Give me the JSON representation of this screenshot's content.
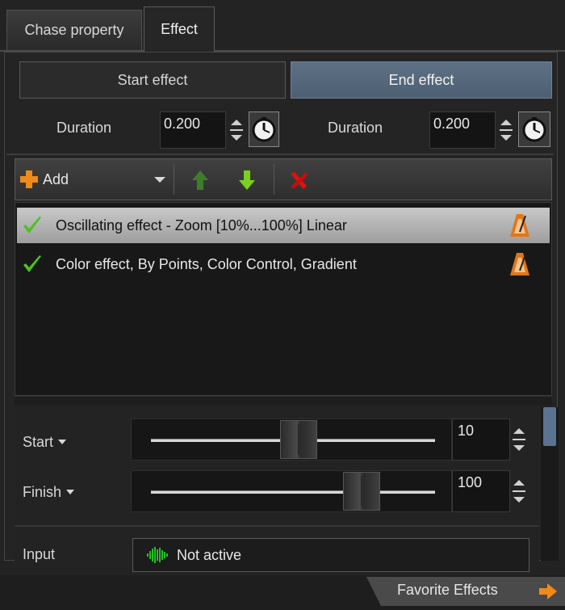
{
  "tabs": [
    {
      "label": "Chase property",
      "active": false
    },
    {
      "label": "Effect",
      "active": true
    }
  ],
  "effect_mode": {
    "start_label": "Start effect",
    "end_label": "End effect",
    "selected": "End effect"
  },
  "durations": {
    "start": {
      "label": "Duration",
      "value": "0.200"
    },
    "end": {
      "label": "Duration",
      "value": "0.200"
    }
  },
  "toolbar": {
    "add_label": "Add",
    "icons": [
      "add-plus-icon",
      "dropdown-arrow-icon",
      "move-up-icon",
      "move-down-icon",
      "delete-x-icon"
    ]
  },
  "effects": [
    {
      "text": "Oscillating effect - Zoom [10%...100%] Linear",
      "enabled": true,
      "selected": true
    },
    {
      "text": "Color effect, By Points, Color Control, Gradient",
      "enabled": true,
      "selected": false
    }
  ],
  "params": {
    "start": {
      "label": "Start",
      "value": "10",
      "slider_fraction": 0.5
    },
    "finish": {
      "label": "Finish",
      "value": "100",
      "slider_fraction": 0.75
    }
  },
  "input": {
    "label": "Input",
    "value": "Not active"
  },
  "favorite": {
    "label": "Favorite Effects"
  },
  "colors": {
    "accent": "#5e7184",
    "check": "#4cc21f",
    "move_up": "#3f7d2a",
    "move_down": "#7ccf1f",
    "delete": "#e01010"
  }
}
